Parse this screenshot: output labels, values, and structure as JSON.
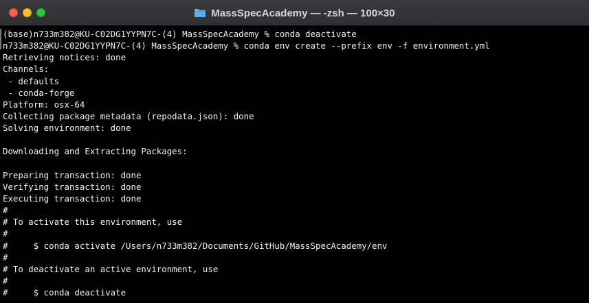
{
  "window": {
    "title": "MassSpecAcademy — -zsh — 100×30"
  },
  "terminal": {
    "lines": [
      "(base)n733m382@KU-C02DG1YYPN7C-(4) MassSpecAcademy % conda deactivate",
      "n733m382@KU-C02DG1YYPN7C-(4) MassSpecAcademy % conda env create --prefix env -f environment.yml",
      "Retrieving notices: done",
      "Channels:",
      " - defaults",
      " - conda-forge",
      "Platform: osx-64",
      "Collecting package metadata (repodata.json): done",
      "Solving environment: done",
      "",
      "Downloading and Extracting Packages:",
      "",
      "Preparing transaction: done",
      "Verifying transaction: done",
      "Executing transaction: done",
      "#",
      "# To activate this environment, use",
      "#",
      "#     $ conda activate /Users/n733m382/Documents/GitHub/MassSpecAcademy/env",
      "#",
      "# To deactivate an active environment, use",
      "#",
      "#     $ conda deactivate"
    ]
  },
  "colors": {
    "background": "#000000",
    "text": "#f2f2f2",
    "titlebar": "#333336",
    "close": "#ff5f57",
    "minimize": "#febc2e",
    "maximize": "#28c840",
    "folder": "#5aaef0"
  },
  "icons": {
    "title_icon": "folder-icon"
  }
}
